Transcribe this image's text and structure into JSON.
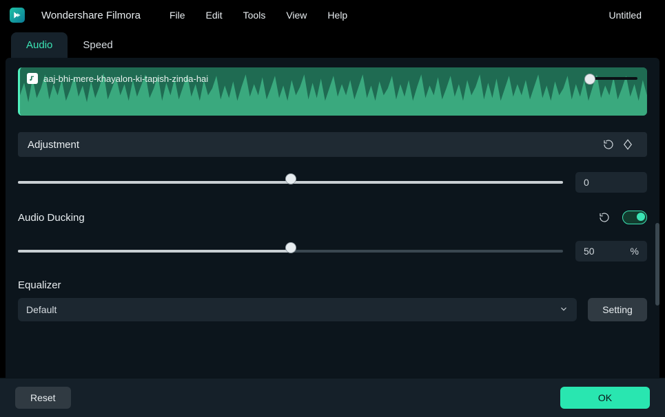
{
  "app": {
    "brand": "Wondershare Filmora",
    "document_title": "Untitled"
  },
  "menubar": {
    "items": [
      "File",
      "Edit",
      "Tools",
      "View",
      "Help"
    ]
  },
  "tabs": {
    "items": [
      {
        "label": "Audio",
        "active": true
      },
      {
        "label": "Speed",
        "active": false
      }
    ]
  },
  "clip": {
    "name": "aaj-bhi-mere-khayalon-ki-tapish-zinda-hai",
    "volume_pct": 8
  },
  "sections": {
    "adjustment": {
      "label": "Adjustment",
      "slider_value": 50,
      "value_display": "0"
    },
    "audio_ducking": {
      "label": "Audio Ducking",
      "enabled": true,
      "slider_pct": 50,
      "value_display": "50",
      "unit": "%"
    },
    "equalizer": {
      "label": "Equalizer",
      "selected": "Default",
      "setting_label": "Setting"
    }
  },
  "footer": {
    "reset": "Reset",
    "ok": "OK"
  },
  "icons": {
    "reset": "reset-icon",
    "keyframe": "keyframe-icon",
    "chevron": "chevron-down-icon",
    "music": "music-note-icon"
  }
}
